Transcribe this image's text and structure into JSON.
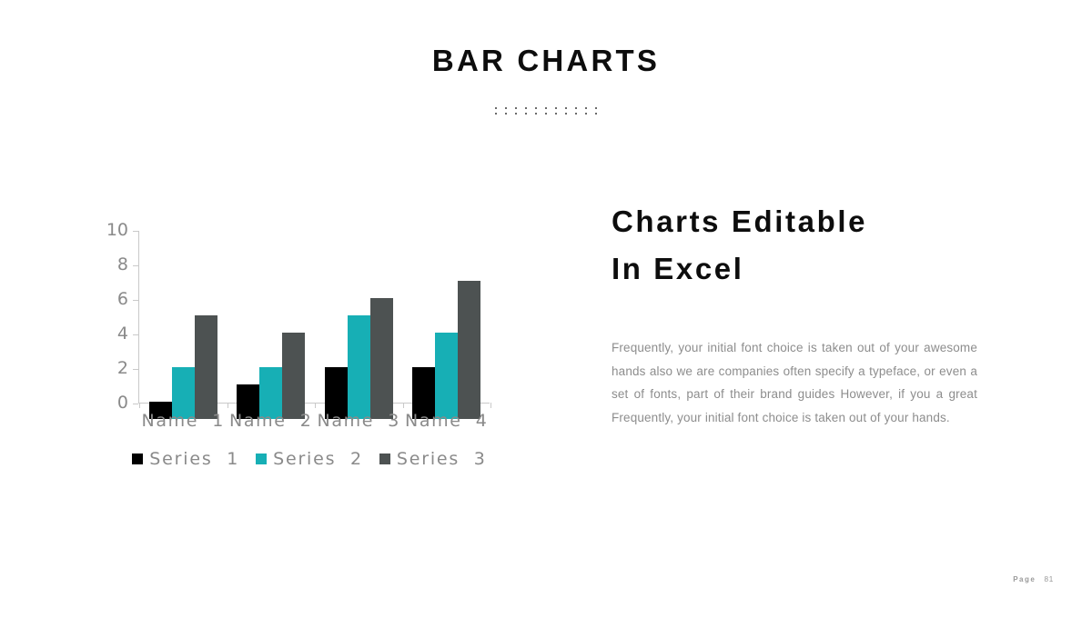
{
  "slide": {
    "title": "BAR CHARTS",
    "divider_icon": "dot-grid-ornament",
    "dot_rows": 2,
    "dot_cols": 11
  },
  "right": {
    "heading": "Charts Editable\nIn Excel",
    "body": "Frequently, your initial font choice is taken out of your awesome hands also we are companies often specify a typeface, or even a set of fonts,  part of their brand guides However, if you a great Frequently, your initial font choice is taken out of your hands."
  },
  "footer": {
    "label": "Page",
    "number": "81"
  },
  "colors": {
    "series1": "#000000",
    "series2": "#17AFB5",
    "series3": "#4D5252",
    "axis": "#c9c9c9",
    "tick_text": "#8a8a8a",
    "body_text": "#8d8d8d",
    "title_text": "#0d0d0d"
  },
  "chart_data": {
    "type": "bar",
    "title": "",
    "xlabel": "",
    "ylabel": "",
    "ylim": [
      0,
      10
    ],
    "yticks": [
      0,
      2,
      4,
      6,
      8,
      10
    ],
    "grid": false,
    "legend_position": "bottom",
    "categories": [
      "Name  1",
      "Name  2",
      "Name  3",
      "Name  4"
    ],
    "series": [
      {
        "name": "Series  1",
        "color": "#000000",
        "values": [
          1,
          2,
          3,
          3
        ]
      },
      {
        "name": "Series  2",
        "color": "#17AFB5",
        "values": [
          3,
          3,
          6,
          5
        ]
      },
      {
        "name": "Series  3",
        "color": "#4D5252",
        "values": [
          6,
          5,
          7,
          8
        ]
      }
    ]
  }
}
